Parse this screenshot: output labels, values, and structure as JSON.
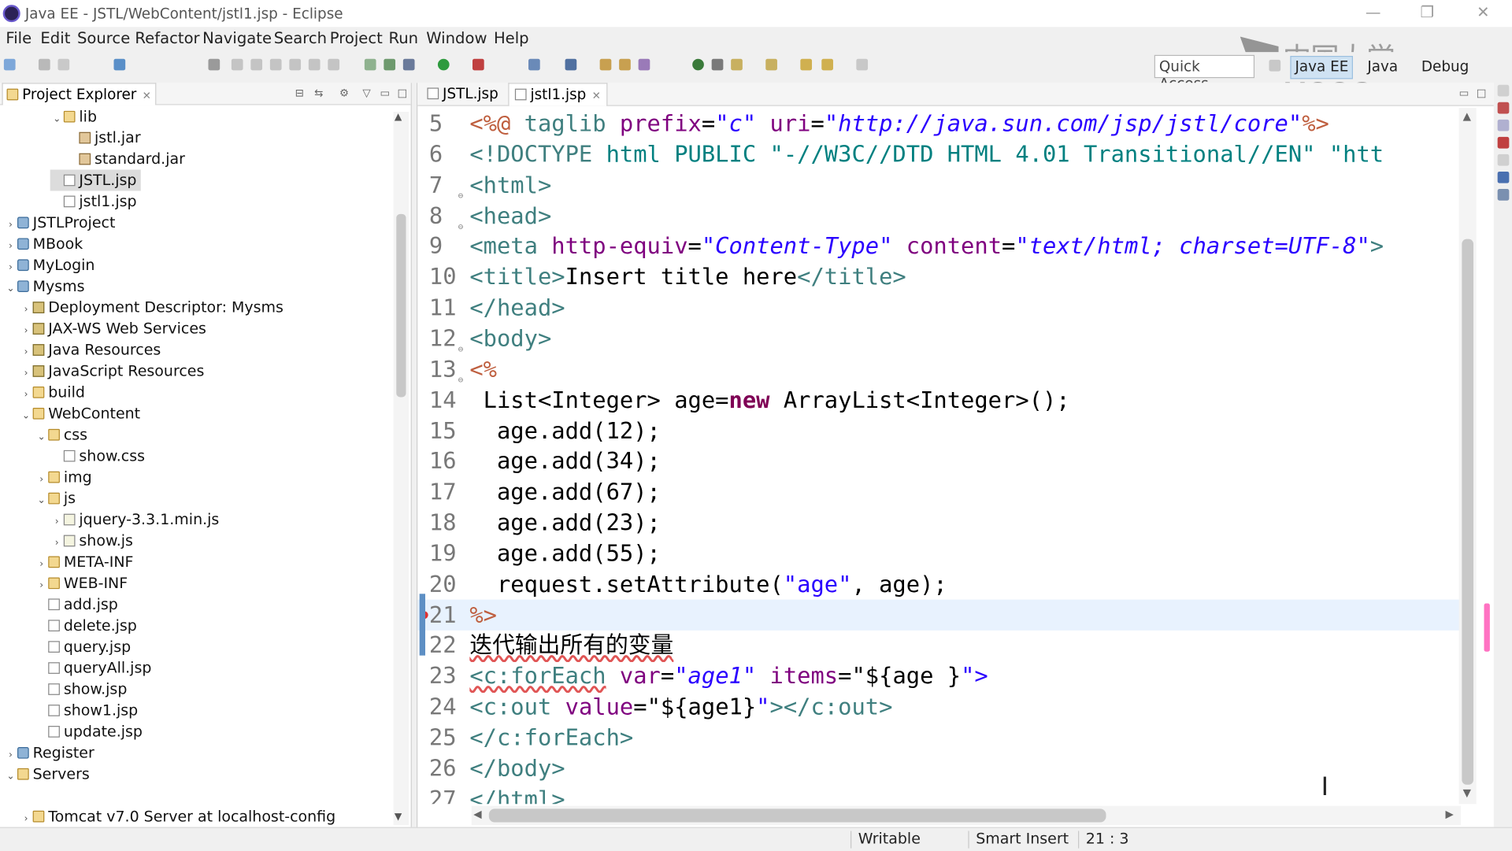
{
  "window": {
    "title": "Java EE - JSTL/WebContent/jstl1.jsp - Eclipse",
    "controls": [
      "—",
      "❐",
      "✕"
    ]
  },
  "watermark": "中国大学MOOC",
  "menu": [
    "File",
    "Edit",
    "Source",
    "Refactor",
    "Navigate",
    "Search",
    "Project",
    "Run",
    "Window",
    "Help"
  ],
  "toolbar": {
    "quick_access": "Quick Access",
    "perspectives": [
      "Java EE",
      "Java",
      "Debug"
    ],
    "active_perspective": "Java EE"
  },
  "explorer": {
    "tab_label": "Project Explorer",
    "close_glyph": "✕",
    "items": [
      {
        "label": "lib",
        "type": "folder",
        "state": "open"
      },
      {
        "label": "jstl.jar",
        "type": "jar",
        "state": "none"
      },
      {
        "label": "standard.jar",
        "type": "jar",
        "state": "none"
      },
      {
        "label": "JSTL.jsp",
        "type": "file",
        "state": "none",
        "selected": true
      },
      {
        "label": "jstl1.jsp",
        "type": "file",
        "state": "none"
      },
      {
        "label": "JSTLProject",
        "type": "project",
        "state": "closed"
      },
      {
        "label": "MBook",
        "type": "project",
        "state": "closed"
      },
      {
        "label": "MyLogin",
        "type": "project",
        "state": "closed"
      },
      {
        "label": "Mysms",
        "type": "project",
        "state": "open"
      },
      {
        "label": "Deployment Descriptor: Mysms",
        "type": "deploy",
        "state": "closed"
      },
      {
        "label": "JAX-WS Web Services",
        "type": "deploy",
        "state": "closed"
      },
      {
        "label": "Java Resources",
        "type": "deploy",
        "state": "closed"
      },
      {
        "label": "JavaScript Resources",
        "type": "deploy",
        "state": "closed"
      },
      {
        "label": "build",
        "type": "folder",
        "state": "closed"
      },
      {
        "label": "WebContent",
        "type": "folder",
        "state": "open"
      },
      {
        "label": "css",
        "type": "folder",
        "state": "open"
      },
      {
        "label": "show.css",
        "type": "file",
        "state": "none"
      },
      {
        "label": "img",
        "type": "folder",
        "state": "closed"
      },
      {
        "label": "js",
        "type": "folder",
        "state": "open"
      },
      {
        "label": "jquery-3.3.1.min.js",
        "type": "js",
        "state": "closed"
      },
      {
        "label": "show.js",
        "type": "js",
        "state": "closed"
      },
      {
        "label": "META-INF",
        "type": "folder",
        "state": "closed"
      },
      {
        "label": "WEB-INF",
        "type": "folder",
        "state": "closed"
      },
      {
        "label": "add.jsp",
        "type": "file",
        "state": "none"
      },
      {
        "label": "delete.jsp",
        "type": "file",
        "state": "none"
      },
      {
        "label": "query.jsp",
        "type": "file",
        "state": "none"
      },
      {
        "label": "queryAll.jsp",
        "type": "file",
        "state": "none"
      },
      {
        "label": "show.jsp",
        "type": "file",
        "state": "none"
      },
      {
        "label": "show1.jsp",
        "type": "file",
        "state": "none"
      },
      {
        "label": "update.jsp",
        "type": "file",
        "state": "none"
      },
      {
        "label": "Register",
        "type": "project",
        "state": "closed"
      },
      {
        "label": "Servers",
        "type": "folder",
        "state": "open"
      },
      {
        "label": "",
        "type": "blank",
        "state": "none"
      },
      {
        "label": "Tomcat v7.0 Server at localhost-config",
        "type": "folder",
        "state": "closed"
      }
    ]
  },
  "editor": {
    "tabs": [
      {
        "label": "JSTL.jsp",
        "active": false
      },
      {
        "label": "jstl1.jsp",
        "active": true
      }
    ],
    "close_glyph": "✕",
    "current_line": 21,
    "lines": [
      {
        "n": "5",
        "fold": false,
        "tokens": [
          [
            "t-jsp",
            "<%@ "
          ],
          [
            "t-tag",
            "taglib "
          ],
          [
            "t-attr",
            "prefix"
          ],
          [
            "",
            "="
          ],
          [
            "t-val",
            "\"c\""
          ],
          [
            "",
            " "
          ],
          [
            "t-attr",
            "uri"
          ],
          [
            "",
            "="
          ],
          [
            "t-val",
            "\"http://java.sun.com/jsp/jstl/core\""
          ],
          [
            "t-jsp",
            "%>"
          ]
        ]
      },
      {
        "n": "6",
        "fold": false,
        "tokens": [
          [
            "t-tag",
            "<!DOCTYPE "
          ],
          [
            "t-dt",
            "html"
          ],
          [
            "",
            " "
          ],
          [
            "t-dt",
            "PUBLIC"
          ],
          [
            "",
            " "
          ],
          [
            "t-dt",
            "\"-//W3C//DTD HTML 4.01 Transitional//EN\""
          ],
          [
            "",
            " "
          ],
          [
            "t-dt",
            "\"htt"
          ]
        ]
      },
      {
        "n": "7",
        "fold": true,
        "tokens": [
          [
            "t-tag",
            "<html>"
          ]
        ]
      },
      {
        "n": "8",
        "fold": true,
        "tokens": [
          [
            "t-tag",
            "<head>"
          ]
        ]
      },
      {
        "n": "9",
        "fold": false,
        "tokens": [
          [
            "t-tag",
            "<meta "
          ],
          [
            "t-attr",
            "http-equiv"
          ],
          [
            "",
            "="
          ],
          [
            "t-val",
            "\"Content-Type\""
          ],
          [
            "",
            " "
          ],
          [
            "t-attr",
            "content"
          ],
          [
            "",
            "="
          ],
          [
            "t-val",
            "\"text/html; charset=UTF-8\""
          ],
          [
            "t-tag",
            ">"
          ]
        ]
      },
      {
        "n": "10",
        "fold": false,
        "tokens": [
          [
            "t-tag",
            "<title>"
          ],
          [
            "",
            "Insert title here"
          ],
          [
            "t-tag",
            "</title>"
          ]
        ]
      },
      {
        "n": "11",
        "fold": false,
        "tokens": [
          [
            "t-tag",
            "</head>"
          ]
        ]
      },
      {
        "n": "12",
        "fold": true,
        "tokens": [
          [
            "t-tag",
            "<body>"
          ]
        ]
      },
      {
        "n": "13",
        "fold": true,
        "tokens": [
          [
            "t-jsp",
            "<%"
          ]
        ]
      },
      {
        "n": "14",
        "fold": false,
        "tokens": [
          [
            "",
            " List<Integer> age="
          ],
          [
            "t-kw",
            "new"
          ],
          [
            "",
            " ArrayList<Integer>();"
          ]
        ]
      },
      {
        "n": "15",
        "fold": false,
        "tokens": [
          [
            "",
            "  age.add(12);"
          ]
        ]
      },
      {
        "n": "16",
        "fold": false,
        "tokens": [
          [
            "",
            "  age.add(34);"
          ]
        ]
      },
      {
        "n": "17",
        "fold": false,
        "tokens": [
          [
            "",
            "  age.add(67);"
          ]
        ]
      },
      {
        "n": "18",
        "fold": false,
        "tokens": [
          [
            "",
            "  age.add(23);"
          ]
        ]
      },
      {
        "n": "19",
        "fold": false,
        "tokens": [
          [
            "",
            "  age.add(55);"
          ]
        ]
      },
      {
        "n": "20",
        "fold": false,
        "tokens": [
          [
            "",
            "  request.setAttribute("
          ],
          [
            "t-str",
            "\"age\""
          ],
          [
            "",
            ", age);"
          ]
        ]
      },
      {
        "n": "21",
        "fold": false,
        "error": true,
        "tokens": [
          [
            "t-jsp",
            "%>"
          ]
        ]
      },
      {
        "n": "22",
        "fold": false,
        "tokens": [
          [
            "squiggle",
            "迭代输出所有的变量"
          ]
        ]
      },
      {
        "n": "23",
        "fold": false,
        "tokens": [
          [
            "t-tag squiggle",
            "<c:forEach"
          ],
          [
            "",
            " "
          ],
          [
            "t-attr",
            "var"
          ],
          [
            "",
            "="
          ],
          [
            "t-val",
            "\"age1\""
          ],
          [
            "",
            " "
          ],
          [
            "t-attr",
            "items"
          ],
          [
            "",
            "=\"${age }"
          ],
          [
            "t-str",
            "\">"
          ]
        ]
      },
      {
        "n": "24",
        "fold": false,
        "tokens": [
          [
            "t-tag",
            "<c:out "
          ],
          [
            "t-attr",
            "value"
          ],
          [
            "",
            "=\"${age1}"
          ],
          [
            "t-str",
            "\""
          ],
          [
            "t-tag",
            "></c:out>"
          ]
        ]
      },
      {
        "n": "25",
        "fold": false,
        "tokens": [
          [
            "t-tag",
            "</c:forEach>"
          ]
        ]
      },
      {
        "n": "26",
        "fold": false,
        "tokens": [
          [
            "t-tag",
            "</body>"
          ]
        ]
      },
      {
        "n": "27",
        "fold": false,
        "tokens": [
          [
            "t-tag",
            "</html>"
          ]
        ]
      }
    ]
  },
  "status": {
    "writable": "Writable",
    "insert_mode": "Smart Insert",
    "position": "21 : 3"
  },
  "colors": {
    "accent": "#5d8fc4",
    "current_line_bg": "#e8f2fe",
    "error": "#e03030",
    "overview_marker": "#ff72c2"
  }
}
